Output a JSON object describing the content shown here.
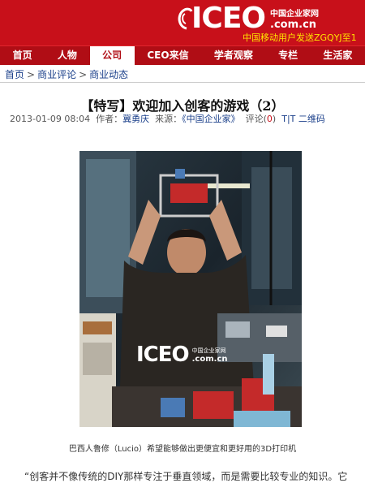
{
  "header": {
    "logo_word": "ICEO",
    "logo_cn": "中国企业家网",
    "logo_domain": ".com.cn",
    "marquee": "中国移动用户发送ZGQYJ至1"
  },
  "nav": [
    {
      "label": "首页",
      "active": false
    },
    {
      "label": "人物",
      "active": false
    },
    {
      "label": "公司",
      "active": true
    },
    {
      "label": "CEO来信",
      "active": false
    },
    {
      "label": "学者观察",
      "active": false
    },
    {
      "label": "专栏",
      "active": false
    },
    {
      "label": "生活家",
      "active": false
    }
  ],
  "breadcrumb": {
    "items": [
      "首页",
      "商业评论",
      "商业动态"
    ],
    "separator": ">"
  },
  "article": {
    "title": "【特写】欢迎加入创客的游戏（2）",
    "date": "2013-01-09 08:04",
    "author_label": "作者：",
    "author": "冀勇庆",
    "source_label": "来源：",
    "source": "《中国企业家》",
    "comments_label": "评论(",
    "comments_count": "0",
    "comments_close": ")",
    "font_toggle": "T|T",
    "qrcode": "二维码",
    "photo_watermark_word": "ICEO",
    "photo_watermark_cn": "中国企业家网",
    "photo_watermark_domain": ".com.cn",
    "caption": "巴西人鲁修（Lucio）希望能够做出更便宜和更好用的3D打印机",
    "body_first_line": "“创客并不像传统的DIY那样专注于垂直领域，而是需要比较专业的知识。它"
  },
  "colors": {
    "brand_red": "#c8101a",
    "nav_red": "#b00d15",
    "link_blue": "#1a3f8a",
    "marquee_yellow": "#ffe400"
  }
}
